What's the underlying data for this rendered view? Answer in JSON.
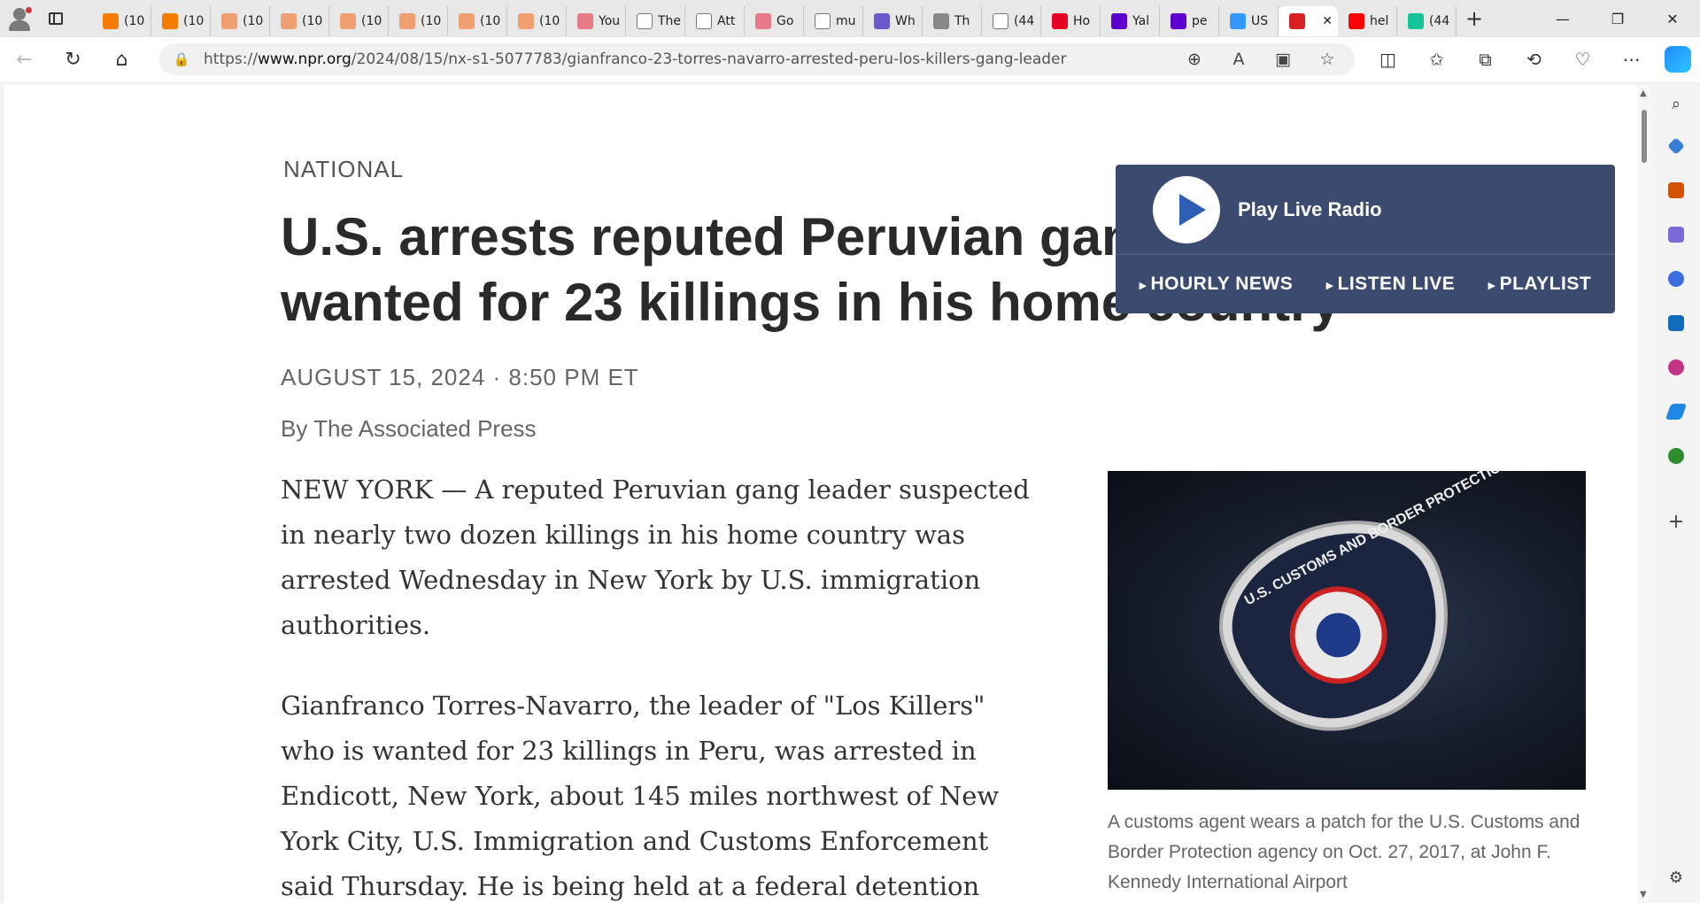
{
  "browser": {
    "tabs": [
      {
        "label": "(10",
        "favicon": "blogger-icon",
        "color": "#f57c00"
      },
      {
        "label": "(10",
        "favicon": "blogger-icon",
        "color": "#f57c00"
      },
      {
        "label": "(10",
        "favicon": "blogger-icon",
        "color": "#f0a070"
      },
      {
        "label": "(10",
        "favicon": "blogger-icon",
        "color": "#f0a070"
      },
      {
        "label": "(10",
        "favicon": "blogger-icon",
        "color": "#f0a070"
      },
      {
        "label": "(10",
        "favicon": "blogger-icon",
        "color": "#f0a070"
      },
      {
        "label": "(10",
        "favicon": "blogger-icon",
        "color": "#f0a070"
      },
      {
        "label": "(10",
        "favicon": "blogger-icon",
        "color": "#f0a070"
      },
      {
        "label": "You",
        "favicon": "youtube-icon",
        "color": "#e87a88"
      },
      {
        "label": "The",
        "favicon": "page-icon",
        "color": "#ffffff"
      },
      {
        "label": "Att",
        "favicon": "page-icon",
        "color": "#ffffff"
      },
      {
        "label": "Go",
        "favicon": "youtube-icon",
        "color": "#e87a88"
      },
      {
        "label": "mu",
        "favicon": "page-icon",
        "color": "#ffffff"
      },
      {
        "label": "Wh",
        "favicon": "shield-icon",
        "color": "#6a5acd"
      },
      {
        "label": "Th",
        "favicon": "dots-icon",
        "color": "#888888"
      },
      {
        "label": "(44",
        "favicon": "page-icon",
        "color": "#ffffff"
      },
      {
        "label": "Ho",
        "favicon": "pinterest-icon",
        "color": "#e60023"
      },
      {
        "label": "Yal",
        "favicon": "yahoo-icon",
        "color": "#5f01d1"
      },
      {
        "label": "pe",
        "favicon": "yahoo-icon",
        "color": "#5f01d1"
      },
      {
        "label": "US",
        "favicon": "aol-icon",
        "color": "#3399ff"
      },
      {
        "label": "",
        "favicon": "npr-icon",
        "color": "#d62021",
        "active": true
      },
      {
        "label": "hel",
        "favicon": "youtube-icon",
        "color": "#ff0000"
      },
      {
        "label": "(44",
        "favicon": "grammarly-icon",
        "color": "#15c39a"
      }
    ],
    "url_prefix": "https://",
    "url_host": "www.npr.org",
    "url_path": "/2024/08/15/nx-s1-5077783/gianfranco-23-torres-navarro-arrested-peru-los-killers-gang-leader"
  },
  "article": {
    "section": "NATIONAL",
    "headline": "U.S. arrests reputed Peruvian gang leader wanted for 23 killings in his home country",
    "dateline": "AUGUST 15, 2024 · 8:50 PM ET",
    "byline": "By The Associated Press",
    "paragraphs": [
      "NEW YORK — A reputed Peruvian gang leader suspected in nearly two dozen killings in his home country was arrested Wednesday in New York by U.S. immigration authorities.",
      "Gianfranco Torres-Navarro, the leader of \"Los Killers\" who is wanted for 23 killings in Peru, was arrested in Endicott, New York, about 145 miles northwest of New York City, U.S. Immigration and Customs Enforcement said Thursday. He is being held at a federal detention"
    ],
    "photo_patch_text": "U.S. CUSTOMS AND BORDER PROTECTION",
    "caption": "A customs agent wears a patch for the U.S. Customs and Border Protection agency on Oct. 27, 2017, at John F. Kennedy International Airport"
  },
  "radio": {
    "play_label": "Play Live Radio",
    "links": [
      "HOURLY NEWS",
      "LISTEN LIVE",
      "PLAYLIST"
    ]
  }
}
